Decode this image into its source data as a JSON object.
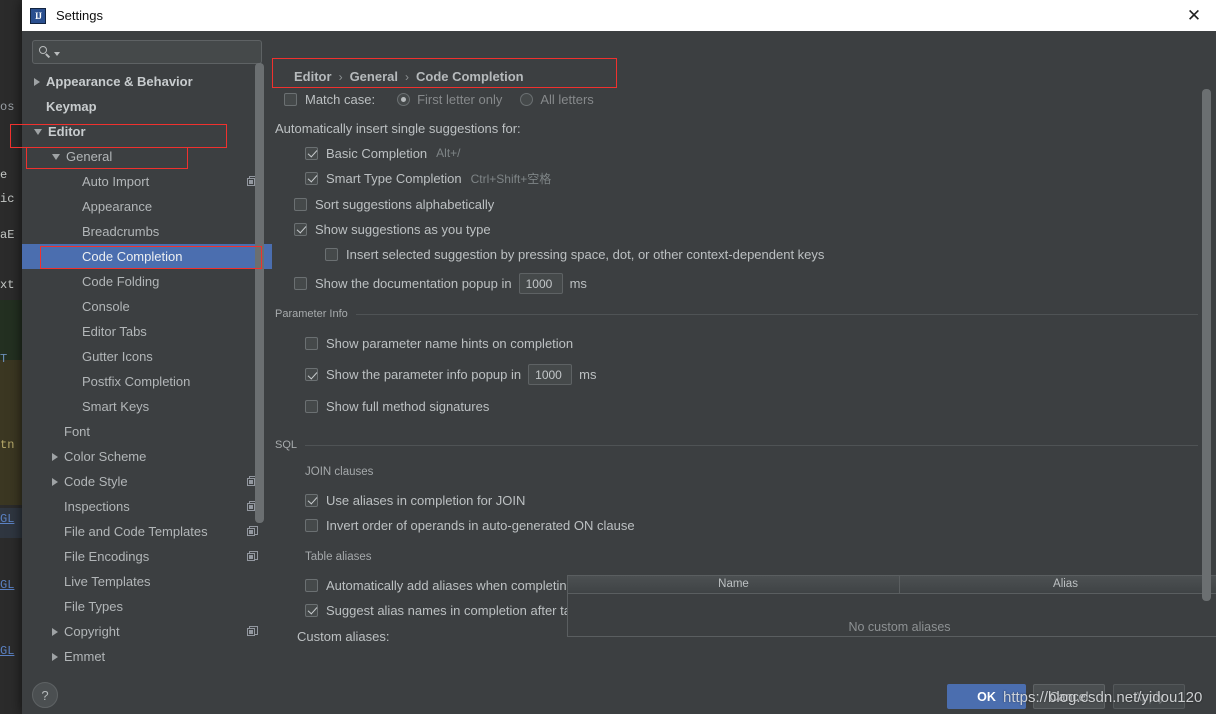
{
  "window": {
    "title": "Settings",
    "app_icon": "intellij-idea-icon",
    "close_label": "✕"
  },
  "sidebar": {
    "search": {
      "value": "",
      "placeholder": "",
      "icon": "search-icon"
    },
    "items": [
      {
        "label": "Appearance & Behavior",
        "arrow": "right",
        "indent": 0,
        "bold": true,
        "selected": false,
        "copy": false
      },
      {
        "label": "Keymap",
        "arrow": "none",
        "indent": 0,
        "bold": true,
        "selected": false,
        "copy": false
      },
      {
        "label": "Editor",
        "arrow": "down",
        "indent": 0,
        "bold": true,
        "selected": false,
        "copy": false
      },
      {
        "label": "General",
        "arrow": "down",
        "indent": 1,
        "bold": false,
        "selected": false,
        "copy": false
      },
      {
        "label": "Auto Import",
        "arrow": "none",
        "indent": 2,
        "bold": false,
        "selected": false,
        "copy": true
      },
      {
        "label": "Appearance",
        "arrow": "none",
        "indent": 2,
        "bold": false,
        "selected": false,
        "copy": false
      },
      {
        "label": "Breadcrumbs",
        "arrow": "none",
        "indent": 2,
        "bold": false,
        "selected": false,
        "copy": false
      },
      {
        "label": "Code Completion",
        "arrow": "none",
        "indent": 2,
        "bold": false,
        "selected": true,
        "copy": false
      },
      {
        "label": "Code Folding",
        "arrow": "none",
        "indent": 2,
        "bold": false,
        "selected": false,
        "copy": false
      },
      {
        "label": "Console",
        "arrow": "none",
        "indent": 2,
        "bold": false,
        "selected": false,
        "copy": false
      },
      {
        "label": "Editor Tabs",
        "arrow": "none",
        "indent": 2,
        "bold": false,
        "selected": false,
        "copy": false
      },
      {
        "label": "Gutter Icons",
        "arrow": "none",
        "indent": 2,
        "bold": false,
        "selected": false,
        "copy": false
      },
      {
        "label": "Postfix Completion",
        "arrow": "none",
        "indent": 2,
        "bold": false,
        "selected": false,
        "copy": false
      },
      {
        "label": "Smart Keys",
        "arrow": "none",
        "indent": 2,
        "bold": false,
        "selected": false,
        "copy": false
      },
      {
        "label": "Font",
        "arrow": "none",
        "indent": 1,
        "bold": false,
        "selected": false,
        "copy": false
      },
      {
        "label": "Color Scheme",
        "arrow": "right",
        "indent": 1,
        "bold": false,
        "selected": false,
        "copy": false
      },
      {
        "label": "Code Style",
        "arrow": "right",
        "indent": 1,
        "bold": false,
        "selected": false,
        "copy": true
      },
      {
        "label": "Inspections",
        "arrow": "none",
        "indent": 1,
        "bold": false,
        "selected": false,
        "copy": true
      },
      {
        "label": "File and Code Templates",
        "arrow": "none",
        "indent": 1,
        "bold": false,
        "selected": false,
        "copy": true
      },
      {
        "label": "File Encodings",
        "arrow": "none",
        "indent": 1,
        "bold": false,
        "selected": false,
        "copy": true
      },
      {
        "label": "Live Templates",
        "arrow": "none",
        "indent": 1,
        "bold": false,
        "selected": false,
        "copy": false
      },
      {
        "label": "File Types",
        "arrow": "none",
        "indent": 1,
        "bold": false,
        "selected": false,
        "copy": false
      },
      {
        "label": "Copyright",
        "arrow": "right",
        "indent": 1,
        "bold": false,
        "selected": false,
        "copy": true
      },
      {
        "label": "Emmet",
        "arrow": "right",
        "indent": 1,
        "bold": false,
        "selected": false,
        "copy": false
      }
    ]
  },
  "breadcrumb": {
    "part1": "Editor",
    "sep1": "›",
    "part2": "General",
    "sep2": "›",
    "part3": "Code Completion"
  },
  "main": {
    "match_case": {
      "label": "Match case:",
      "checked": false,
      "options": [
        {
          "label": "First letter only",
          "selected": true
        },
        {
          "label": "All letters",
          "selected": false
        }
      ]
    },
    "auto_insert_header": "Automatically insert single suggestions for:",
    "auto_insert_items": [
      {
        "label": "Basic Completion",
        "checked": true,
        "shortcut": "Alt+/"
      },
      {
        "label": "Smart Type Completion",
        "checked": true,
        "shortcut": "Ctrl+Shift+空格"
      }
    ],
    "sort_alpha": {
      "label": "Sort suggestions alphabetically",
      "checked": false
    },
    "show_as_type": {
      "label": "Show suggestions as you type",
      "checked": true
    },
    "insert_selected": {
      "label": "Insert selected suggestion by pressing space, dot, or other context-dependent keys",
      "checked": false
    },
    "doc_popup": {
      "label": "Show the documentation popup in",
      "checked": false,
      "value": "1000",
      "unit": "ms"
    },
    "parameter_info": {
      "group": "Parameter Info",
      "items": [
        {
          "label": "Show parameter name hints on completion",
          "checked": false
        },
        {
          "label": "Show the parameter info popup in",
          "checked": true,
          "value": "1000",
          "unit": "ms"
        },
        {
          "label": "Show full method signatures",
          "checked": false
        }
      ]
    },
    "sql": {
      "group": "SQL",
      "join_clauses_label": "JOIN clauses",
      "join_items": [
        {
          "label": "Use aliases in completion for JOIN",
          "checked": true
        },
        {
          "label": "Invert order of operands in auto-generated ON clause",
          "checked": false
        }
      ],
      "table_aliases_label": "Table aliases",
      "table_items": [
        {
          "label": "Automatically add aliases when completing table names",
          "checked": false
        },
        {
          "label": "Suggest alias names in completion after table names",
          "checked": true
        }
      ],
      "custom_aliases_label": "Custom aliases:",
      "table": {
        "columns": [
          "Name",
          "Alias"
        ],
        "rows": [],
        "empty_text": "No custom aliases",
        "add_label": "+",
        "remove_label": "–"
      }
    }
  },
  "footer": {
    "help_label": "?",
    "ok_label": "OK",
    "cancel_label": "Cancel",
    "apply_label": "Apply"
  },
  "watermark": "https://blog.csdn.net/yidou120",
  "background_text": {
    "fragments": [
      "os",
      "e",
      "ic",
      "aE",
      "xt",
      "T",
      "tn",
      "GL",
      "GL",
      "GL"
    ]
  },
  "colors": {
    "accent": "#4b6eaf",
    "annotation": "#f0312e",
    "panel": "#3c3f41",
    "field": "#45494a",
    "text": "#bcc0c2"
  }
}
